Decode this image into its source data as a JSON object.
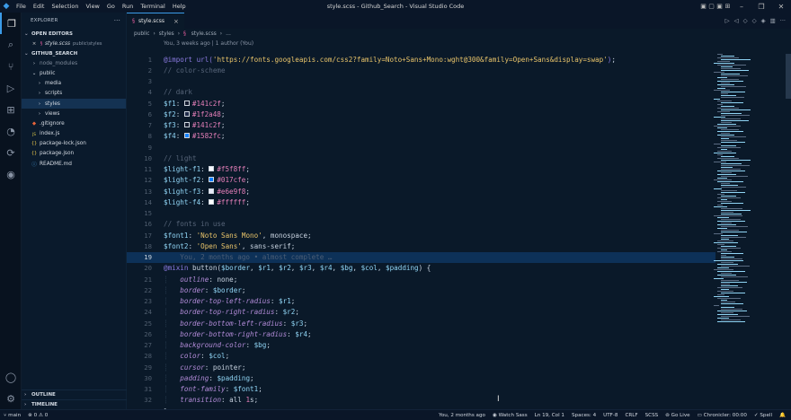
{
  "window": {
    "title": "style.scss - Github_Search - Visual Studio Code"
  },
  "menu": [
    "File",
    "Edit",
    "Selection",
    "View",
    "Go",
    "Run",
    "Terminal",
    "Help"
  ],
  "sidebar": {
    "title": "EXPLORER",
    "open_editors_label": "OPEN EDITORS",
    "open_file": {
      "name": "style.scss",
      "path": "public\\styles"
    },
    "project_label": "GITHUB_SEARCH",
    "tree": [
      {
        "label": "node_modules",
        "kind": "folder",
        "depth": 1,
        "dim": true
      },
      {
        "label": "public",
        "kind": "folder-open",
        "depth": 1
      },
      {
        "label": "media",
        "kind": "folder",
        "depth": 2
      },
      {
        "label": "scripts",
        "kind": "folder",
        "depth": 2
      },
      {
        "label": "styles",
        "kind": "folder",
        "depth": 2,
        "selected": true
      },
      {
        "label": "views",
        "kind": "folder",
        "depth": 2
      },
      {
        "label": ".gitignore",
        "kind": "git",
        "depth": 1
      },
      {
        "label": "index.js",
        "kind": "js",
        "depth": 1
      },
      {
        "label": "package-lock.json",
        "kind": "json",
        "depth": 1
      },
      {
        "label": "package.json",
        "kind": "json",
        "depth": 1
      },
      {
        "label": "README.md",
        "kind": "info",
        "depth": 1
      }
    ],
    "outline_label": "OUTLINE",
    "timeline_label": "TIMELINE"
  },
  "tab": {
    "label": "style.scss"
  },
  "breadcrumb": [
    "public",
    "styles",
    "style.scss",
    "…"
  ],
  "blame_header": "You, 3 weeks ago | 1 author (You)",
  "ghost_blame": "You, 2 months ago • almost complete …",
  "code_lines": [
    [
      [
        "c-at",
        "@import "
      ],
      [
        "c-url",
        "url("
      ],
      [
        "c-str",
        "'https://fonts.googleapis.com/css2?family=Noto+Sans+Mono:wght@300&family=Open+Sans&display=swap'"
      ],
      [
        "c-url",
        ")"
      ],
      [
        "c-punc",
        ";"
      ]
    ],
    [
      [
        "c-com",
        "// color-scheme"
      ]
    ],
    [],
    [
      [
        "c-com",
        "// dark"
      ]
    ],
    [
      [
        "c-var",
        "$f1"
      ],
      [
        "c-punc",
        ": "
      ],
      [
        "sw",
        "#141c2f"
      ],
      [
        "c-hex",
        "#141c2f"
      ],
      [
        "c-punc",
        ";"
      ]
    ],
    [
      [
        "c-var",
        "$f2"
      ],
      [
        "c-punc",
        ": "
      ],
      [
        "sw",
        "#1f2a48"
      ],
      [
        "c-hex",
        "#1f2a48"
      ],
      [
        "c-punc",
        ";"
      ]
    ],
    [
      [
        "c-var",
        "$f3"
      ],
      [
        "c-punc",
        ": "
      ],
      [
        "sw",
        "#141c2f"
      ],
      [
        "c-hex",
        "#141c2f"
      ],
      [
        "c-punc",
        ";"
      ]
    ],
    [
      [
        "c-var",
        "$f4"
      ],
      [
        "c-punc",
        ": "
      ],
      [
        "sw",
        "#1582fc"
      ],
      [
        "c-hex",
        "#1582fc"
      ],
      [
        "c-punc",
        ";"
      ]
    ],
    [],
    [
      [
        "c-com",
        "// light"
      ]
    ],
    [
      [
        "c-var",
        "$light-f1"
      ],
      [
        "c-punc",
        ": "
      ],
      [
        "sw",
        "#f5f8ff"
      ],
      [
        "c-hex",
        "#f5f8ff"
      ],
      [
        "c-punc",
        ";"
      ]
    ],
    [
      [
        "c-var",
        "$light-f2"
      ],
      [
        "c-punc",
        ": "
      ],
      [
        "sw",
        "#017cfe"
      ],
      [
        "c-hex",
        "#017cfe"
      ],
      [
        "c-punc",
        ";"
      ]
    ],
    [
      [
        "c-var",
        "$light-f3"
      ],
      [
        "c-punc",
        ": "
      ],
      [
        "sw",
        "#e6e9f8"
      ],
      [
        "c-hex",
        "#e6e9f8"
      ],
      [
        "c-punc",
        ";"
      ]
    ],
    [
      [
        "c-var",
        "$light-f4"
      ],
      [
        "c-punc",
        ": "
      ],
      [
        "sw",
        "#ffffff"
      ],
      [
        "c-hex",
        "#ffffff"
      ],
      [
        "c-punc",
        ";"
      ]
    ],
    [],
    [
      [
        "c-com",
        "// fonts in use"
      ]
    ],
    [
      [
        "c-var",
        "$font1"
      ],
      [
        "c-punc",
        ": "
      ],
      [
        "c-str",
        "'Noto Sans Mono'"
      ],
      [
        "c-punc",
        ", monospace;"
      ]
    ],
    [
      [
        "c-var",
        "$font2"
      ],
      [
        "c-punc",
        ": "
      ],
      [
        "c-str",
        "'Open Sans'"
      ],
      [
        "c-punc",
        ", sans-serif;"
      ]
    ],
    [
      [
        "ghost",
        ""
      ]
    ],
    [
      [
        "c-at",
        "@mixin "
      ],
      [
        "c-fn",
        "button("
      ],
      [
        "c-var",
        "$border"
      ],
      [
        "c-punc",
        ", "
      ],
      [
        "c-var",
        "$r1"
      ],
      [
        "c-punc",
        ", "
      ],
      [
        "c-var",
        "$r2"
      ],
      [
        "c-punc",
        ", "
      ],
      [
        "c-var",
        "$r3"
      ],
      [
        "c-punc",
        ", "
      ],
      [
        "c-var",
        "$r4"
      ],
      [
        "c-punc",
        ", "
      ],
      [
        "c-var",
        "$bg"
      ],
      [
        "c-punc",
        ", "
      ],
      [
        "c-var",
        "$col"
      ],
      [
        "c-punc",
        ", "
      ],
      [
        "c-var",
        "$padding"
      ],
      [
        "c-punc",
        ") {"
      ]
    ],
    [
      [
        "guide",
        "    "
      ],
      [
        "c-prop",
        "outline"
      ],
      [
        "c-punc",
        ": none;"
      ]
    ],
    [
      [
        "guide",
        "    "
      ],
      [
        "c-prop",
        "border"
      ],
      [
        "c-punc",
        ": "
      ],
      [
        "c-var",
        "$border"
      ],
      [
        "c-punc",
        ";"
      ]
    ],
    [
      [
        "guide",
        "    "
      ],
      [
        "c-prop",
        "border-top-left-radius"
      ],
      [
        "c-punc",
        ": "
      ],
      [
        "c-var",
        "$r1"
      ],
      [
        "c-punc",
        ";"
      ]
    ],
    [
      [
        "guide",
        "    "
      ],
      [
        "c-prop",
        "border-top-right-radius"
      ],
      [
        "c-punc",
        ": "
      ],
      [
        "c-var",
        "$r2"
      ],
      [
        "c-punc",
        ";"
      ]
    ],
    [
      [
        "guide",
        "    "
      ],
      [
        "c-prop",
        "border-bottom-left-radius"
      ],
      [
        "c-punc",
        ": "
      ],
      [
        "c-var",
        "$r3"
      ],
      [
        "c-punc",
        ";"
      ]
    ],
    [
      [
        "guide",
        "    "
      ],
      [
        "c-prop",
        "border-bottom-right-radius"
      ],
      [
        "c-punc",
        ": "
      ],
      [
        "c-var",
        "$r4"
      ],
      [
        "c-punc",
        ";"
      ]
    ],
    [
      [
        "guide",
        "    "
      ],
      [
        "c-prop",
        "background-color"
      ],
      [
        "c-punc",
        ": "
      ],
      [
        "c-var",
        "$bg"
      ],
      [
        "c-punc",
        ";"
      ]
    ],
    [
      [
        "guide",
        "    "
      ],
      [
        "c-prop",
        "color"
      ],
      [
        "c-punc",
        ": "
      ],
      [
        "c-var",
        "$col"
      ],
      [
        "c-punc",
        ";"
      ]
    ],
    [
      [
        "guide",
        "    "
      ],
      [
        "c-prop",
        "cursor"
      ],
      [
        "c-punc",
        ": pointer;"
      ]
    ],
    [
      [
        "guide",
        "    "
      ],
      [
        "c-prop",
        "padding"
      ],
      [
        "c-punc",
        ": "
      ],
      [
        "c-var",
        "$padding"
      ],
      [
        "c-punc",
        ";"
      ]
    ],
    [
      [
        "guide",
        "    "
      ],
      [
        "c-prop",
        "font-family"
      ],
      [
        "c-punc",
        ": "
      ],
      [
        "c-var",
        "$font1"
      ],
      [
        "c-punc",
        ";"
      ]
    ],
    [
      [
        "guide",
        "    "
      ],
      [
        "c-prop",
        "transition"
      ],
      [
        "c-punc",
        ": all "
      ],
      [
        "c-num",
        "1"
      ],
      [
        "c-punc",
        "s;"
      ]
    ],
    [
      [
        "c-punc",
        "}"
      ]
    ]
  ],
  "current_line": 19,
  "status": {
    "branch": "main",
    "problems": "⊗ 0 ⚠ 0",
    "blame": "You, 2 months ago",
    "watch_sass": "Watch Sass",
    "position": "Ln 19, Col 1",
    "spaces": "Spaces: 4",
    "encoding": "UTF-8",
    "eol": "CRLF",
    "language": "SCSS",
    "go_live": "Go Live",
    "chronicler": "Chronicler: 00:00",
    "spell": "Spell"
  },
  "icons": {
    "files": "files-icon",
    "search": "search-icon",
    "git": "source-control-icon",
    "run": "run-debug-icon",
    "ext": "extensions-icon",
    "remote": "remote-icon",
    "account": "account-icon",
    "settings": "gear-icon"
  }
}
